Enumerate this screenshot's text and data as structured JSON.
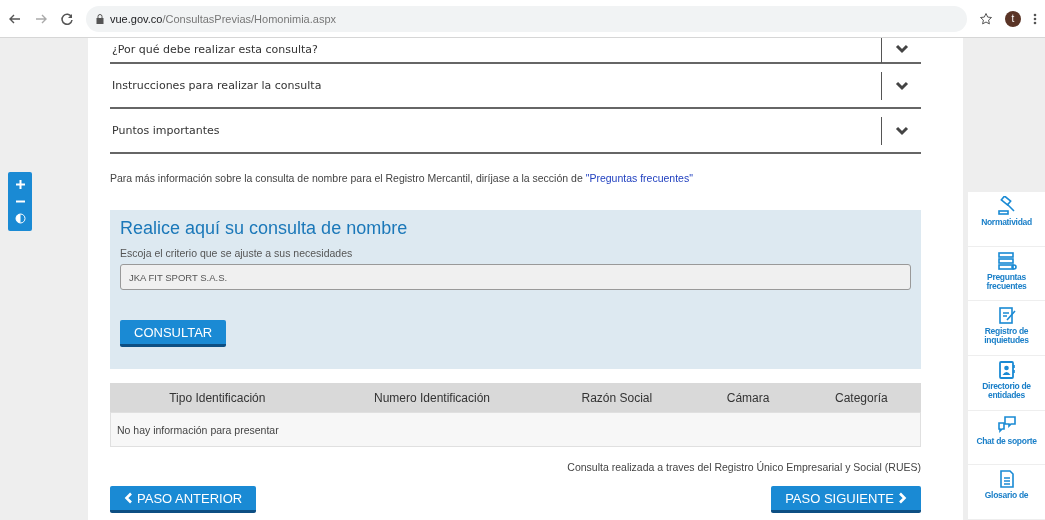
{
  "browser": {
    "url_domain": "vue.gov.co",
    "url_path": "/ConsultasPrevias/Homonimia.aspx",
    "avatar_letter": "t"
  },
  "accordion": [
    {
      "title": "¿Por qué debe realizar esta consulta?",
      "expanded": false
    },
    {
      "title": "Instrucciones para realizar la consulta",
      "expanded": false
    },
    {
      "title": "Puntos importantes",
      "expanded": false
    }
  ],
  "info": {
    "text": "Para más información sobre la consulta de nombre para el Registro Mercantil, diríjase a la sección de",
    "link": "\"Preguntas frecuentes\""
  },
  "query": {
    "title": "Realice aquí su consulta de nombre",
    "subtitle": "Escoja el criterio que se ajuste a sus necesidades",
    "input_value": "JKA FIT SPORT S.A.S.",
    "button": "CONSULTAR"
  },
  "table": {
    "columns": [
      "Tipo Identificación",
      "Numero Identificación",
      "Razón Social",
      "Cámara",
      "Categoría"
    ],
    "empty_message": "No hay información para presentar"
  },
  "footer_note": "Consulta realizada a traves del Registro Único Empresarial y Social (RUES)",
  "nav": {
    "previous": "PASO ANTERIOR",
    "next": "PASO SIGUIENTE"
  },
  "sidebar": [
    {
      "kind": "gavel",
      "label": "Normatividad"
    },
    {
      "kind": "faq",
      "label": "Preguntas frecuentes"
    },
    {
      "kind": "register",
      "label": "Registro de inquietudes"
    },
    {
      "kind": "directory",
      "label": "Directorio de entidades"
    },
    {
      "kind": "chat",
      "label": "Chat de soporte"
    },
    {
      "kind": "glossary",
      "label": "Glosario de"
    }
  ]
}
